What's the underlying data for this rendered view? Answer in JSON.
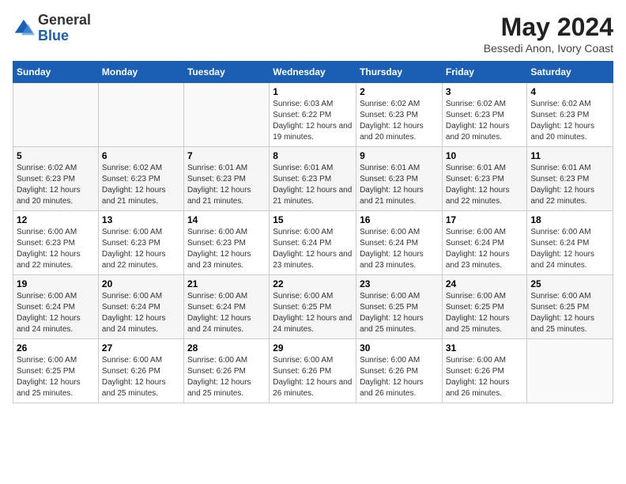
{
  "logo": {
    "general": "General",
    "blue": "Blue"
  },
  "title": {
    "month_year": "May 2024",
    "location": "Bessedi Anon, Ivory Coast"
  },
  "days_of_week": [
    "Sunday",
    "Monday",
    "Tuesday",
    "Wednesday",
    "Thursday",
    "Friday",
    "Saturday"
  ],
  "weeks": [
    [
      {
        "day": "",
        "info": ""
      },
      {
        "day": "",
        "info": ""
      },
      {
        "day": "",
        "info": ""
      },
      {
        "day": "1",
        "info": "Sunrise: 6:03 AM\nSunset: 6:22 PM\nDaylight: 12 hours and 19 minutes."
      },
      {
        "day": "2",
        "info": "Sunrise: 6:02 AM\nSunset: 6:23 PM\nDaylight: 12 hours and 20 minutes."
      },
      {
        "day": "3",
        "info": "Sunrise: 6:02 AM\nSunset: 6:23 PM\nDaylight: 12 hours and 20 minutes."
      },
      {
        "day": "4",
        "info": "Sunrise: 6:02 AM\nSunset: 6:23 PM\nDaylight: 12 hours and 20 minutes."
      }
    ],
    [
      {
        "day": "5",
        "info": "Sunrise: 6:02 AM\nSunset: 6:23 PM\nDaylight: 12 hours and 20 minutes."
      },
      {
        "day": "6",
        "info": "Sunrise: 6:02 AM\nSunset: 6:23 PM\nDaylight: 12 hours and 21 minutes."
      },
      {
        "day": "7",
        "info": "Sunrise: 6:01 AM\nSunset: 6:23 PM\nDaylight: 12 hours and 21 minutes."
      },
      {
        "day": "8",
        "info": "Sunrise: 6:01 AM\nSunset: 6:23 PM\nDaylight: 12 hours and 21 minutes."
      },
      {
        "day": "9",
        "info": "Sunrise: 6:01 AM\nSunset: 6:23 PM\nDaylight: 12 hours and 21 minutes."
      },
      {
        "day": "10",
        "info": "Sunrise: 6:01 AM\nSunset: 6:23 PM\nDaylight: 12 hours and 22 minutes."
      },
      {
        "day": "11",
        "info": "Sunrise: 6:01 AM\nSunset: 6:23 PM\nDaylight: 12 hours and 22 minutes."
      }
    ],
    [
      {
        "day": "12",
        "info": "Sunrise: 6:00 AM\nSunset: 6:23 PM\nDaylight: 12 hours and 22 minutes."
      },
      {
        "day": "13",
        "info": "Sunrise: 6:00 AM\nSunset: 6:23 PM\nDaylight: 12 hours and 22 minutes."
      },
      {
        "day": "14",
        "info": "Sunrise: 6:00 AM\nSunset: 6:23 PM\nDaylight: 12 hours and 23 minutes."
      },
      {
        "day": "15",
        "info": "Sunrise: 6:00 AM\nSunset: 6:24 PM\nDaylight: 12 hours and 23 minutes."
      },
      {
        "day": "16",
        "info": "Sunrise: 6:00 AM\nSunset: 6:24 PM\nDaylight: 12 hours and 23 minutes."
      },
      {
        "day": "17",
        "info": "Sunrise: 6:00 AM\nSunset: 6:24 PM\nDaylight: 12 hours and 23 minutes."
      },
      {
        "day": "18",
        "info": "Sunrise: 6:00 AM\nSunset: 6:24 PM\nDaylight: 12 hours and 24 minutes."
      }
    ],
    [
      {
        "day": "19",
        "info": "Sunrise: 6:00 AM\nSunset: 6:24 PM\nDaylight: 12 hours and 24 minutes."
      },
      {
        "day": "20",
        "info": "Sunrise: 6:00 AM\nSunset: 6:24 PM\nDaylight: 12 hours and 24 minutes."
      },
      {
        "day": "21",
        "info": "Sunrise: 6:00 AM\nSunset: 6:24 PM\nDaylight: 12 hours and 24 minutes."
      },
      {
        "day": "22",
        "info": "Sunrise: 6:00 AM\nSunset: 6:25 PM\nDaylight: 12 hours and 24 minutes."
      },
      {
        "day": "23",
        "info": "Sunrise: 6:00 AM\nSunset: 6:25 PM\nDaylight: 12 hours and 25 minutes."
      },
      {
        "day": "24",
        "info": "Sunrise: 6:00 AM\nSunset: 6:25 PM\nDaylight: 12 hours and 25 minutes."
      },
      {
        "day": "25",
        "info": "Sunrise: 6:00 AM\nSunset: 6:25 PM\nDaylight: 12 hours and 25 minutes."
      }
    ],
    [
      {
        "day": "26",
        "info": "Sunrise: 6:00 AM\nSunset: 6:25 PM\nDaylight: 12 hours and 25 minutes."
      },
      {
        "day": "27",
        "info": "Sunrise: 6:00 AM\nSunset: 6:26 PM\nDaylight: 12 hours and 25 minutes."
      },
      {
        "day": "28",
        "info": "Sunrise: 6:00 AM\nSunset: 6:26 PM\nDaylight: 12 hours and 25 minutes."
      },
      {
        "day": "29",
        "info": "Sunrise: 6:00 AM\nSunset: 6:26 PM\nDaylight: 12 hours and 26 minutes."
      },
      {
        "day": "30",
        "info": "Sunrise: 6:00 AM\nSunset: 6:26 PM\nDaylight: 12 hours and 26 minutes."
      },
      {
        "day": "31",
        "info": "Sunrise: 6:00 AM\nSunset: 6:26 PM\nDaylight: 12 hours and 26 minutes."
      },
      {
        "day": "",
        "info": ""
      }
    ]
  ]
}
